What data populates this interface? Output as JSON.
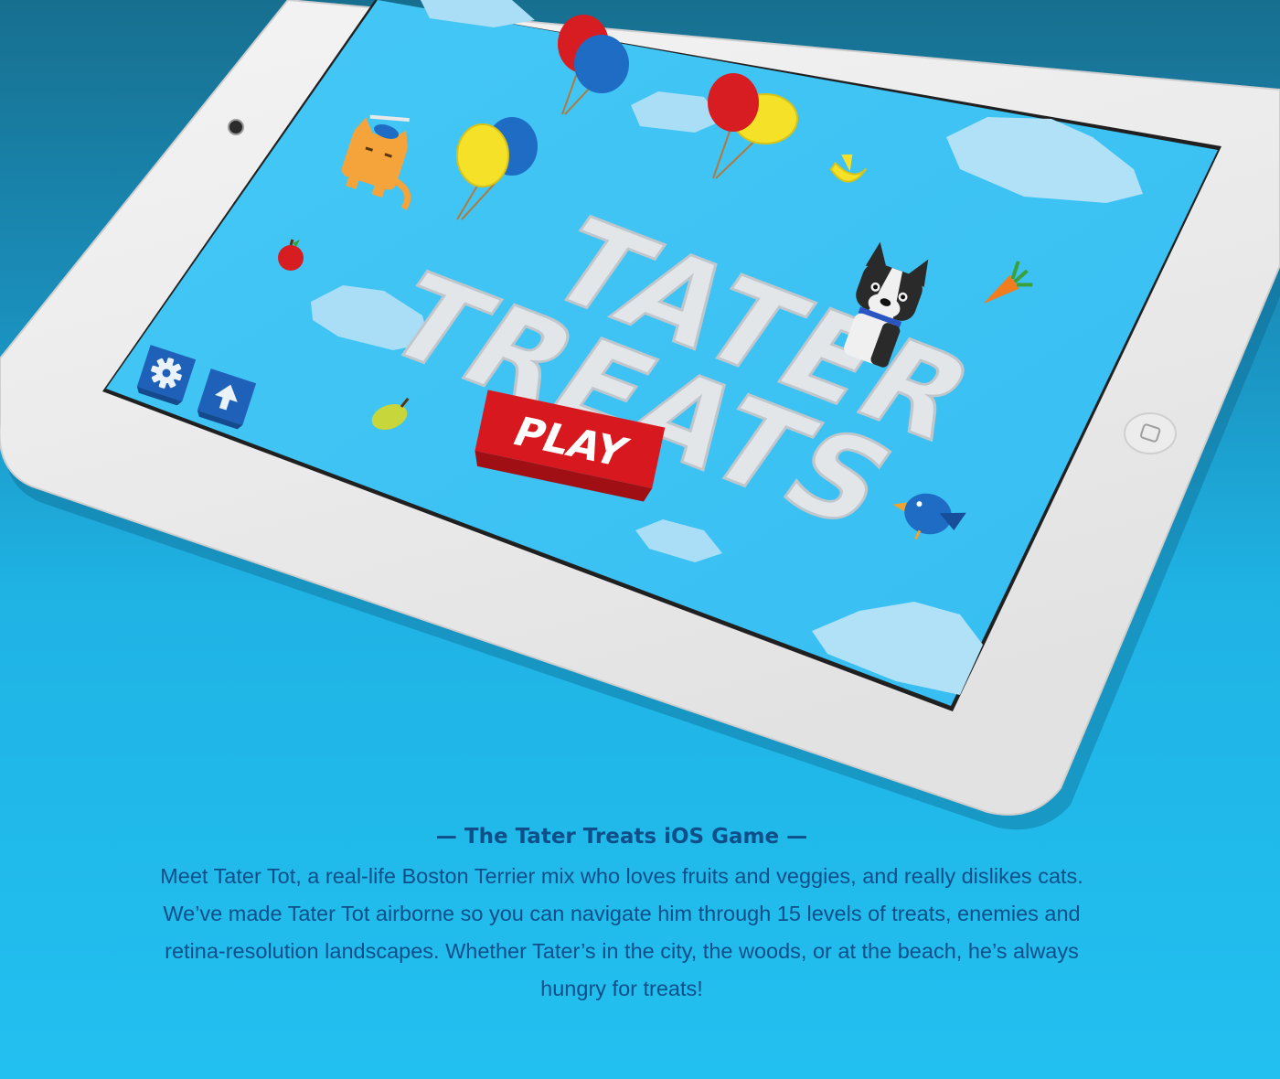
{
  "game": {
    "title_line1": "TATER",
    "title_line2": "TREATS",
    "play_label": "PLAY",
    "settings_button_icon": "gear-icon",
    "upload_button_icon": "arrow-up-icon"
  },
  "device": {
    "camera_icon": "camera-icon",
    "home_button_icon": "home-button-icon"
  },
  "caption": {
    "title": "— The Tater Treats iOS Game —",
    "body": "Meet Tater Tot, a real-life Boston Terrier mix who loves fruits and veggies, and really dislikes cats. We’ve made Tater Tot airborne so you can navigate him through 15 levels of treats, enemies and retina-resolution landscapes. Whether Tater’s in the city, the woods, or at the beach, he’s always hungry for treats!"
  },
  "colors": {
    "sky": "#3cc3f4",
    "play_red": "#d7181e",
    "balloon_red": "#d81d22",
    "balloon_blue": "#1f6cc4",
    "balloon_yellow": "#f4e128",
    "caption_text": "#0e4f8a"
  }
}
